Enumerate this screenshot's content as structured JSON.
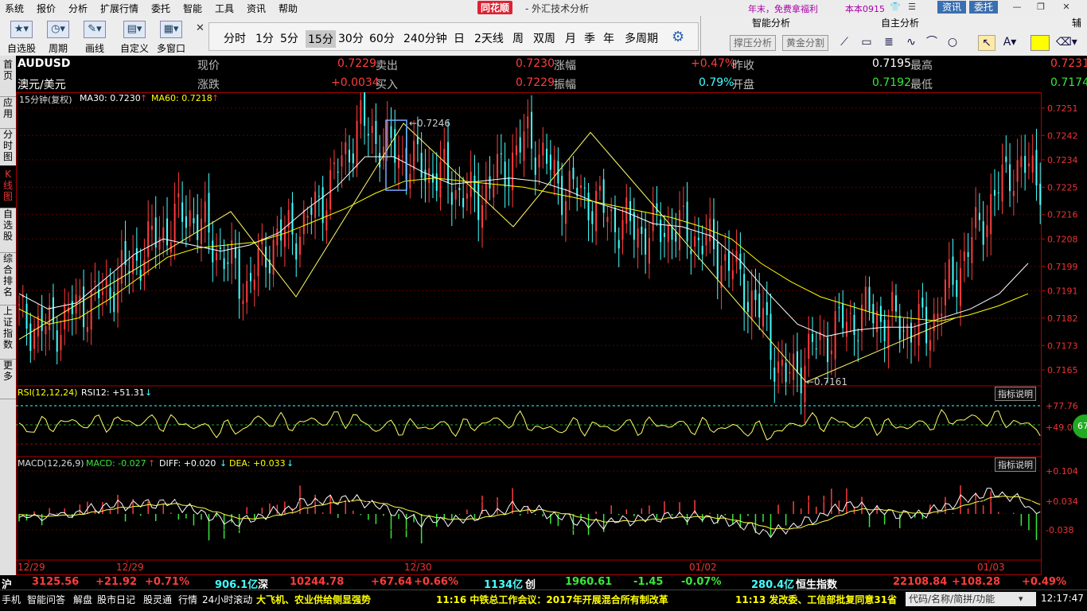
{
  "menubar": {
    "items": [
      "系统",
      "报价",
      "分析",
      "扩展行情",
      "委托",
      "智能",
      "工具",
      "资讯",
      "帮助"
    ],
    "brand": "同花顺",
    "title": "- 外汇技术分析",
    "promo": "年末，免费拿福利",
    "version": "本本0915",
    "news_btn": "资讯",
    "trade_btn": "委托"
  },
  "toolbar": {
    "buttons": [
      "自选股",
      "周期",
      "画线",
      "自定义",
      "多窗口"
    ],
    "periods": [
      "分时",
      "1分",
      "5分",
      "15分",
      "30分",
      "60分",
      "240分钟",
      "日",
      "2天线",
      "周",
      "双周",
      "月",
      "季",
      "年",
      "多周期"
    ],
    "selected_period": "15分"
  },
  "right_panel": {
    "tabs": [
      "智能分析",
      "自主分析",
      "辅"
    ],
    "buttons": [
      "撑压分析",
      "黄金分割"
    ]
  },
  "sidetabs": [
    "首页",
    "应用",
    "分时图",
    "K线图",
    "自选股",
    "综合排名",
    "上证指数",
    "更多"
  ],
  "quote": {
    "symbol": "AUDUSD",
    "name": "澳元/美元",
    "now_label": "现价",
    "now": "0.7229",
    "chg_label": "涨跌",
    "chg": "+0.0034",
    "ask_label": "卖出",
    "ask": "0.7230",
    "bid_label": "买入",
    "bid": "0.7229",
    "pct_label": "涨幅",
    "pct": "+0.47%",
    "amp_label": "振幅",
    "amp": "0.79%",
    "prev_label": "昨收",
    "prev": "0.7195",
    "open_label": "开盘",
    "open": "0.7192",
    "high_label": "最高",
    "high": "0.7231",
    "low_label": "最低",
    "low": "0.7174"
  },
  "main_chart": {
    "period_label": "15分钟(复权)",
    "ma30": "MA30: 0.7230",
    "ma60": "MA60: 0.7218",
    "high_mark": "0.7246",
    "low_mark": "0.7161",
    "y_ticks": [
      "0.7251",
      "0.7242",
      "0.7234",
      "0.7225",
      "0.7216",
      "0.7208",
      "0.7199",
      "0.7191",
      "0.7182",
      "0.7173",
      "0.7165"
    ],
    "x_labels": [
      "12/29",
      "12/29",
      "12/30",
      "01/02",
      "01/03"
    ]
  },
  "rsi": {
    "title": "RSI(12,12,24)",
    "value": "RSI12: +51.31",
    "ticks": [
      "+77.76",
      "+49.02"
    ],
    "explain": "指标说明",
    "badge": "67"
  },
  "macd": {
    "title": "MACD(12,26,9)",
    "macd": "MACD: -0.027",
    "diff": "DIFF: +0.020",
    "dea": "DEA: +0.033",
    "ticks": [
      "+0.104",
      "+0.034",
      "-0.038"
    ],
    "explain": "指标说明"
  },
  "chart_data": {
    "type": "candlestick",
    "title": "AUDUSD 澳元/美元 15分钟(复权)",
    "x_labels": [
      "12/29",
      "12/29",
      "12/30",
      "01/02",
      "01/03"
    ],
    "ylim": [
      0.716,
      0.7252
    ],
    "y_ticks": [
      0.7251,
      0.7242,
      0.7234,
      0.7225,
      0.7216,
      0.7208,
      0.7199,
      0.7191,
      0.7182,
      0.7173,
      0.7165
    ],
    "close_path": [
      0.7182,
      0.7178,
      0.7185,
      0.719,
      0.72,
      0.721,
      0.7217,
      0.7205,
      0.7192,
      0.7208,
      0.7212,
      0.7226,
      0.7246,
      0.7238,
      0.7232,
      0.7228,
      0.722,
      0.723,
      0.7242,
      0.7226,
      0.7222,
      0.7214,
      0.721,
      0.7212,
      0.7208,
      0.72,
      0.7186,
      0.7161,
      0.7172,
      0.718,
      0.7184,
      0.718,
      0.7178,
      0.7196,
      0.7215,
      0.7232,
      0.7229
    ],
    "ma30_path": [
      0.719,
      0.7185,
      0.7187,
      0.7195,
      0.7203,
      0.7208,
      0.7206,
      0.7204,
      0.7206,
      0.721,
      0.7218,
      0.7225,
      0.7235,
      0.7235,
      0.723,
      0.7226,
      0.7227,
      0.7228,
      0.7227,
      0.7224,
      0.722,
      0.7217,
      0.7213,
      0.7212,
      0.7209,
      0.7201,
      0.719,
      0.718,
      0.7176,
      0.7178,
      0.7179,
      0.7179,
      0.7182,
      0.7185,
      0.719,
      0.72
    ],
    "ma60_path": [
      0.7185,
      0.718,
      0.7182,
      0.7188,
      0.7195,
      0.7202,
      0.7205,
      0.7206,
      0.7207,
      0.721,
      0.7214,
      0.7218,
      0.7223,
      0.7227,
      0.7228,
      0.7227,
      0.7226,
      0.7225,
      0.7223,
      0.7221,
      0.7219,
      0.7217,
      0.7215,
      0.7212,
      0.7208,
      0.72,
      0.7194,
      0.7189,
      0.7186,
      0.7183,
      0.7182,
      0.7181,
      0.7183,
      0.7186,
      0.719
    ],
    "zigzag": [
      0.7175,
      0.7217,
      0.7189,
      0.7246,
      0.7212,
      0.7243,
      0.7161,
      0.7182
    ],
    "rsi_level": 51.31,
    "macd_levels": {
      "macd": -0.027,
      "diff": 0.02,
      "dea": 0.033
    }
  },
  "indexbar": {
    "sh_label": "沪",
    "sh_val": "3125.56",
    "sh_chg": "+21.92",
    "sh_pct": "+0.71%",
    "sh_amt": "906.1亿",
    "sz_label": "深",
    "sz_val": "10244.78",
    "sz_chg": "+67.64",
    "sz_pct": "+0.66%",
    "sz_amt": "1134亿",
    "cy_label": "创",
    "cy_val": "1960.61",
    "cy_chg": "-1.45",
    "cy_pct": "-0.07%",
    "cy_amt": "280.4亿",
    "hs_label": "恒生指数",
    "hs_val": "22108.84",
    "hs_chg": "+108.28",
    "hs_pct": "+0.49%"
  },
  "statusbar": {
    "items": [
      "手机",
      "智能问答",
      "解盘",
      "股市日记",
      "股灵通",
      "行情",
      "24小时滚动"
    ],
    "news1": "大飞机、农业供给侧显强势",
    "news2": "11:16 中铁总工作会议：2017年开展混合所有制改革",
    "news3": "11:13 发改委、工信部批复同意31省",
    "search": "代码/名称/简拼/功能",
    "time": "12:17:47"
  },
  "colors": {
    "up": "#ff3c3c",
    "down": "#4ff",
    "ma30": "#ffffff",
    "ma60": "#ffff00",
    "grid": "#5a0000"
  }
}
